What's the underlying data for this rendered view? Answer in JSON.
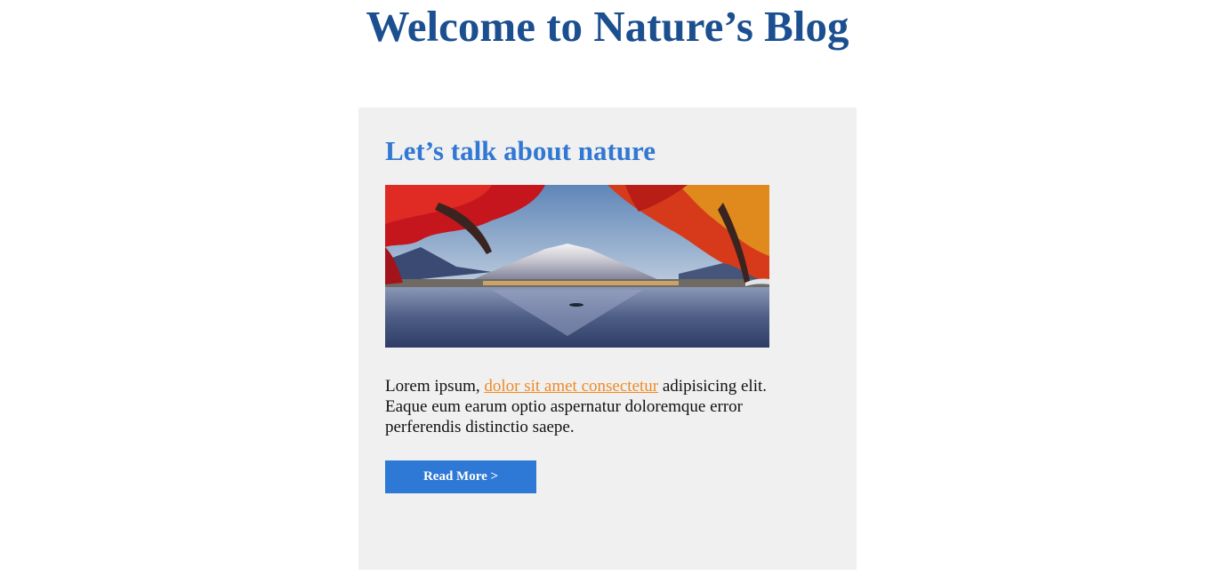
{
  "header": {
    "title": "Welcome to Nature’s Blog"
  },
  "post": {
    "heading": "Let’s talk about nature",
    "image_alt": "Mount Fuji with red maple leaves reflected in a lake",
    "excerpt_before": "Lorem ipsum, ",
    "excerpt_link": "dolor sit amet consectetur",
    "excerpt_after": " adipisicing elit. Eaque eum earum optio aspernatur doloremque error perferendis distinctio saepe.",
    "read_more_label": "Read More >"
  },
  "colors": {
    "title": "#1b4f8f",
    "heading": "#3178d4",
    "link": "#f08a24",
    "button": "#2f79d6",
    "card_bg": "#f0f0f0"
  }
}
